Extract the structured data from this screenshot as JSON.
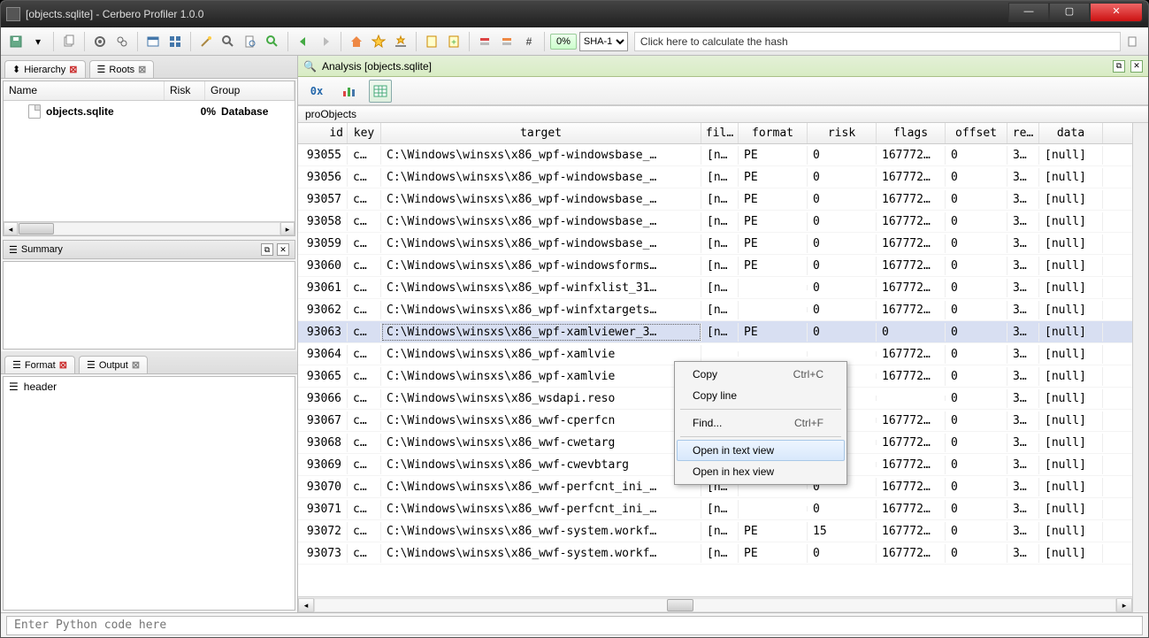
{
  "window": {
    "title": "[objects.sqlite] - Cerbero Profiler 1.0.0"
  },
  "toolbar": {
    "percent": "0%",
    "hash_algo": "SHA-1",
    "hash_hint": "Click here to calculate the hash"
  },
  "left": {
    "tabs": [
      {
        "icon": "hierarchy-icon",
        "label": "Hierarchy",
        "closable": true
      },
      {
        "icon": "roots-icon",
        "label": "Roots",
        "closable": true
      }
    ],
    "hier": {
      "cols": [
        "Name",
        "Risk",
        "Group"
      ],
      "row": {
        "name": "objects.sqlite",
        "risk": "0%",
        "group": "Database"
      }
    },
    "summary_title": "Summary",
    "format_tabs": [
      {
        "label": "Format",
        "closable": true
      },
      {
        "label": "Output",
        "closable": true
      }
    ],
    "format_item": "header"
  },
  "analysis": {
    "label": "Analysis [objects.sqlite]"
  },
  "views": {
    "hex_label": "0x"
  },
  "grid": {
    "name": "proObjects",
    "cols": [
      "id",
      "key",
      "target",
      "fil…",
      "format",
      "risk",
      "flags",
      "offset",
      "re…",
      "data"
    ],
    "rows": [
      {
        "id": "93055",
        "key": "c…",
        "target": "C:\\Windows\\winsxs\\x86_wpf-windowsbase_…",
        "fil": "[n…",
        "format": "PE",
        "risk": "0",
        "flags": "167772…",
        "offset": "0",
        "re": "3…",
        "data": "[null]"
      },
      {
        "id": "93056",
        "key": "c…",
        "target": "C:\\Windows\\winsxs\\x86_wpf-windowsbase_…",
        "fil": "[n…",
        "format": "PE",
        "risk": "0",
        "flags": "167772…",
        "offset": "0",
        "re": "3…",
        "data": "[null]"
      },
      {
        "id": "93057",
        "key": "c…",
        "target": "C:\\Windows\\winsxs\\x86_wpf-windowsbase_…",
        "fil": "[n…",
        "format": "PE",
        "risk": "0",
        "flags": "167772…",
        "offset": "0",
        "re": "3…",
        "data": "[null]"
      },
      {
        "id": "93058",
        "key": "c…",
        "target": "C:\\Windows\\winsxs\\x86_wpf-windowsbase_…",
        "fil": "[n…",
        "format": "PE",
        "risk": "0",
        "flags": "167772…",
        "offset": "0",
        "re": "3…",
        "data": "[null]"
      },
      {
        "id": "93059",
        "key": "c…",
        "target": "C:\\Windows\\winsxs\\x86_wpf-windowsbase_…",
        "fil": "[n…",
        "format": "PE",
        "risk": "0",
        "flags": "167772…",
        "offset": "0",
        "re": "3…",
        "data": "[null]"
      },
      {
        "id": "93060",
        "key": "c…",
        "target": "C:\\Windows\\winsxs\\x86_wpf-windowsforms…",
        "fil": "[n…",
        "format": "PE",
        "risk": "0",
        "flags": "167772…",
        "offset": "0",
        "re": "3…",
        "data": "[null]"
      },
      {
        "id": "93061",
        "key": "c…",
        "target": "C:\\Windows\\winsxs\\x86_wpf-winfxlist_31…",
        "fil": "[n…",
        "format": "",
        "risk": "0",
        "flags": "167772…",
        "offset": "0",
        "re": "3…",
        "data": "[null]"
      },
      {
        "id": "93062",
        "key": "c…",
        "target": "C:\\Windows\\winsxs\\x86_wpf-winfxtargets…",
        "fil": "[n…",
        "format": "",
        "risk": "0",
        "flags": "167772…",
        "offset": "0",
        "re": "3…",
        "data": "[null]"
      },
      {
        "id": "93063",
        "key": "c…",
        "target": "C:\\Windows\\winsxs\\x86_wpf-xamlviewer_3…",
        "fil": "[n…",
        "format": "PE",
        "risk": "0",
        "flags": "0",
        "offset": "0",
        "re": "3…",
        "data": "[null]"
      },
      {
        "id": "93064",
        "key": "c…",
        "target": "C:\\Windows\\winsxs\\x86_wpf-xamlvie",
        "fil": "",
        "format": "",
        "risk": "",
        "flags": "167772…",
        "offset": "0",
        "re": "3…",
        "data": "[null]"
      },
      {
        "id": "93065",
        "key": "c…",
        "target": "C:\\Windows\\winsxs\\x86_wpf-xamlvie",
        "fil": "",
        "format": "",
        "risk": "",
        "flags": "167772…",
        "offset": "0",
        "re": "3…",
        "data": "[null]"
      },
      {
        "id": "93066",
        "key": "c…",
        "target": "C:\\Windows\\winsxs\\x86_wsdapi.reso",
        "fil": "",
        "format": "",
        "risk": "",
        "flags": "",
        "offset": "0",
        "re": "3…",
        "data": "[null]"
      },
      {
        "id": "93067",
        "key": "c…",
        "target": "C:\\Windows\\winsxs\\x86_wwf-cperfcn",
        "fil": "",
        "format": "",
        "risk": "",
        "flags": "167772…",
        "offset": "0",
        "re": "3…",
        "data": "[null]"
      },
      {
        "id": "93068",
        "key": "c…",
        "target": "C:\\Windows\\winsxs\\x86_wwf-cwetarg",
        "fil": "",
        "format": "",
        "risk": "",
        "flags": "167772…",
        "offset": "0",
        "re": "3…",
        "data": "[null]"
      },
      {
        "id": "93069",
        "key": "c…",
        "target": "C:\\Windows\\winsxs\\x86_wwf-cwevbtarg",
        "fil": "",
        "format": "",
        "risk": "",
        "flags": "167772…",
        "offset": "0",
        "re": "3…",
        "data": "[null]"
      },
      {
        "id": "93070",
        "key": "c…",
        "target": "C:\\Windows\\winsxs\\x86_wwf-perfcnt_ini_…",
        "fil": "[n…",
        "format": "",
        "risk": "0",
        "flags": "167772…",
        "offset": "0",
        "re": "3…",
        "data": "[null]"
      },
      {
        "id": "93071",
        "key": "c…",
        "target": "C:\\Windows\\winsxs\\x86_wwf-perfcnt_ini_…",
        "fil": "[n…",
        "format": "",
        "risk": "0",
        "flags": "167772…",
        "offset": "0",
        "re": "3…",
        "data": "[null]"
      },
      {
        "id": "93072",
        "key": "c…",
        "target": "C:\\Windows\\winsxs\\x86_wwf-system.workf…",
        "fil": "[n…",
        "format": "PE",
        "risk": "15",
        "flags": "167772…",
        "offset": "0",
        "re": "3…",
        "data": "[null]"
      },
      {
        "id": "93073",
        "key": "c…",
        "target": "C:\\Windows\\winsxs\\x86_wwf-system.workf…",
        "fil": "[n…",
        "format": "PE",
        "risk": "0",
        "flags": "167772…",
        "offset": "0",
        "re": "3…",
        "data": "[null]"
      }
    ],
    "selected_index": 8
  },
  "ctx": {
    "items": [
      {
        "label": "Copy",
        "shortcut": "Ctrl+C"
      },
      {
        "label": "Copy line",
        "shortcut": ""
      },
      {
        "sep": true
      },
      {
        "label": "Find...",
        "shortcut": "Ctrl+F"
      },
      {
        "sep": true
      },
      {
        "label": "Open in text view",
        "shortcut": "",
        "hover": true
      },
      {
        "label": "Open in hex view",
        "shortcut": ""
      }
    ]
  },
  "status": {
    "placeholder": "Enter Python code here"
  }
}
